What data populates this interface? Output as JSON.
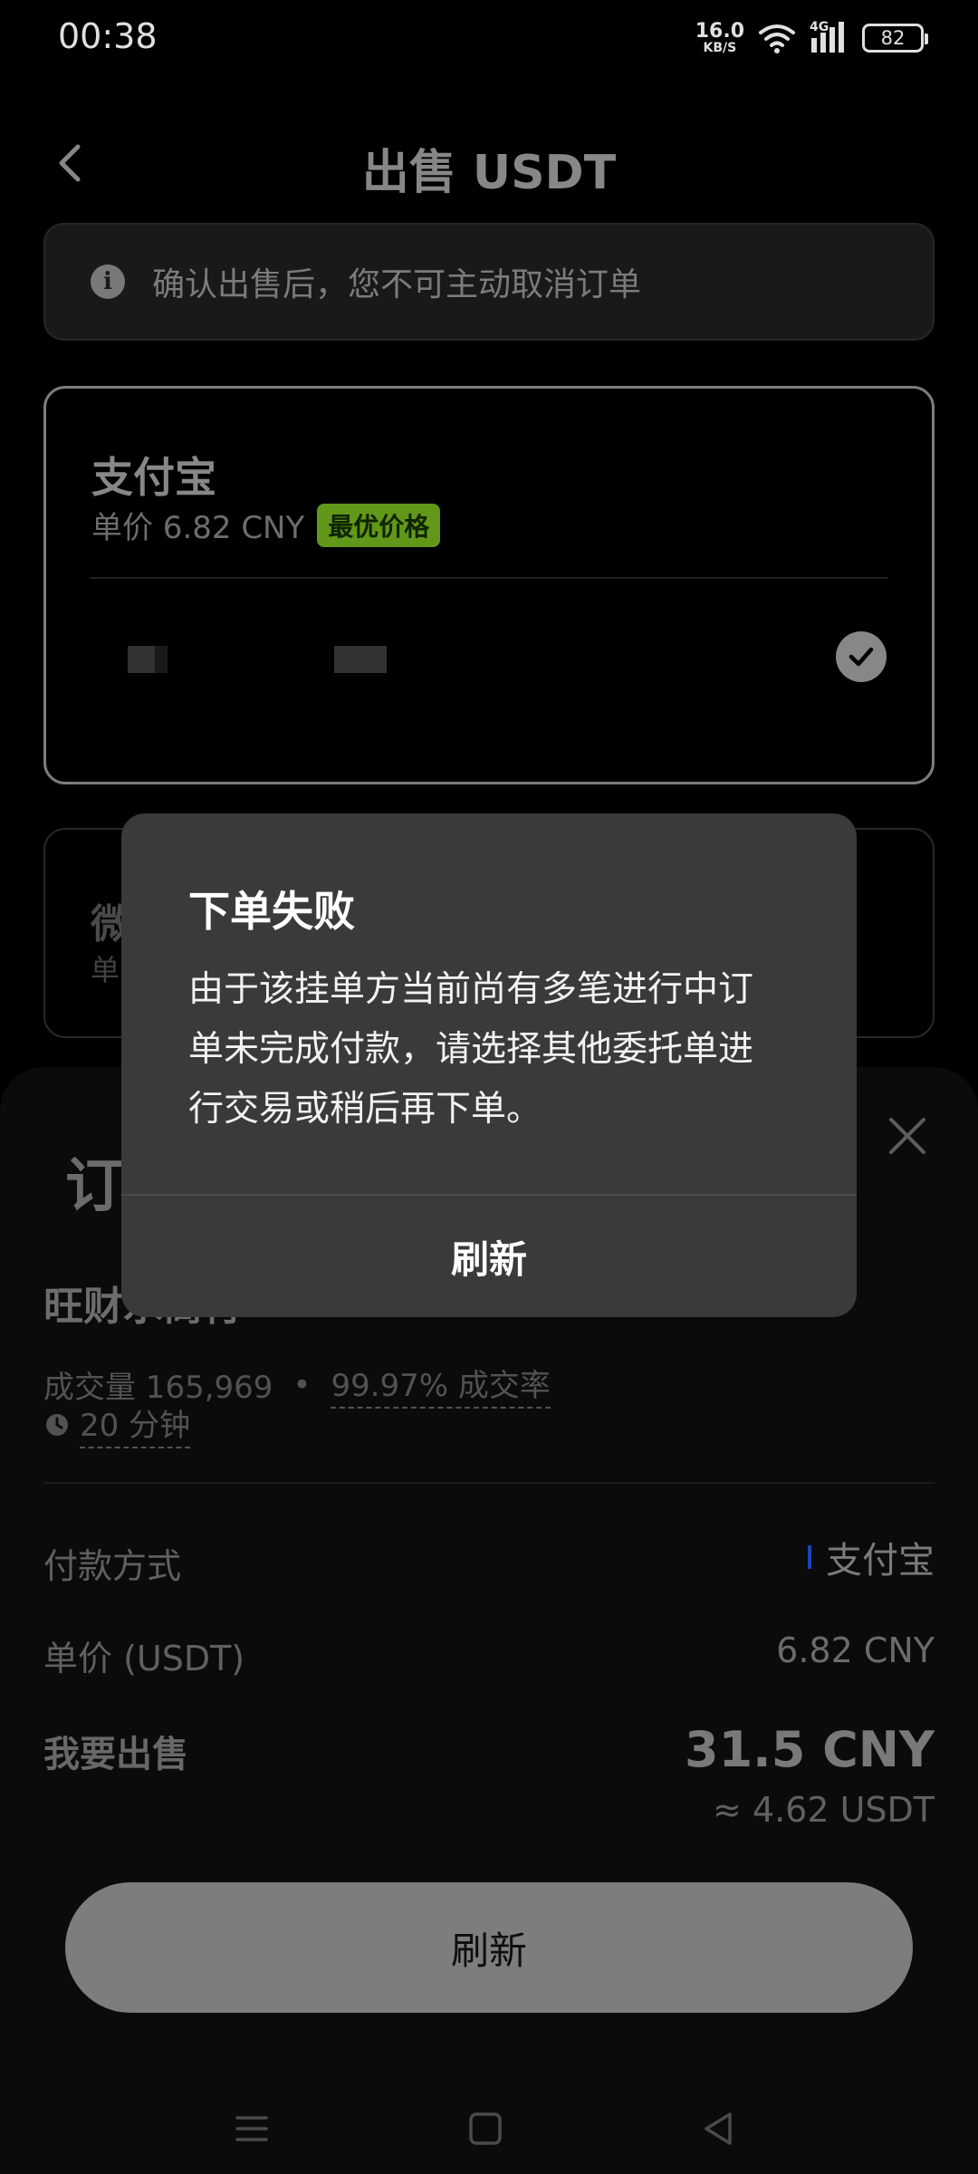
{
  "status_bar": {
    "time": "00:38",
    "net_speed_value": "16.0",
    "net_speed_unit": "KB/S",
    "network": "4G",
    "battery": "82"
  },
  "header": {
    "title": "出售 USDT"
  },
  "notice": {
    "text": "确认出售后，您不可主动取消订单"
  },
  "payment_options": [
    {
      "name": "支付宝",
      "price": "单价 6.82 CNY",
      "badge": "最优价格",
      "selected": true
    },
    {
      "name": "微",
      "price": "单"
    }
  ],
  "order_sheet": {
    "title": "订",
    "merchant_name": "旺财水商行",
    "volume": "成交量 165,969",
    "separator": "•",
    "completion_rate": "99.97% 成交率",
    "payment_time": "20 分钟",
    "payment_method_label": "付款方式",
    "payment_method_value": "支付宝",
    "unit_price_label": "单价 (USDT)",
    "unit_price_value": "6.82 CNY",
    "sell_label": "我要出售",
    "sell_amount": "31.5 CNY",
    "sell_approx": "≈ 4.62 USDT",
    "button_label": "刷新"
  },
  "dialog": {
    "title": "下单失败",
    "body": "由于该挂单方当前尚有多笔进行中订单未完成付款，请选择其他委托单进行交易或稍后再下单。",
    "button_label": "刷新"
  },
  "colors": {
    "badge_green": "#6fae1e",
    "dialog_bg": "#3a3a3a",
    "accent_blue": "#1d4ed8"
  }
}
